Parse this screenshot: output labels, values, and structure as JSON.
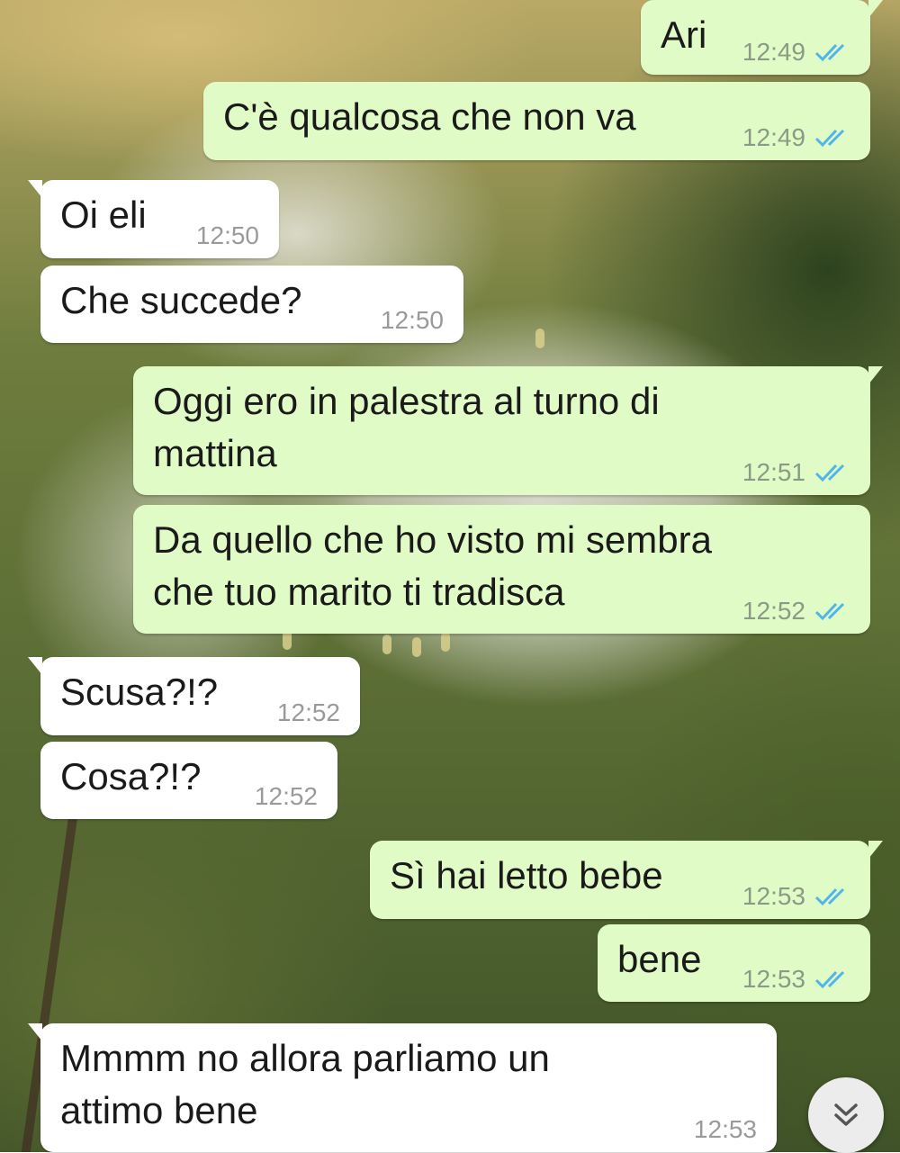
{
  "chat": {
    "messages": [
      {
        "direction": "outgoing",
        "text": "Ari",
        "time": "12:49",
        "status": "read"
      },
      {
        "direction": "outgoing",
        "text": "C'è qualcosa che non va",
        "time": "12:49",
        "status": "read"
      },
      {
        "direction": "incoming",
        "text": "Oi eli",
        "time": "12:50"
      },
      {
        "direction": "incoming",
        "text": "Che succede?",
        "time": "12:50"
      },
      {
        "direction": "outgoing",
        "text": "Oggi ero in palestra al turno di\nmattina",
        "time": "12:51",
        "status": "read"
      },
      {
        "direction": "outgoing",
        "text": "Da quello che ho visto mi sembra\nche tuo marito ti tradisca",
        "time": "12:52",
        "status": "read"
      },
      {
        "direction": "incoming",
        "text": "Scusa?!?",
        "time": "12:52"
      },
      {
        "direction": "incoming",
        "text": "Cosa?!?",
        "time": "12:52"
      },
      {
        "direction": "outgoing",
        "text": "Sì hai letto bebe",
        "time": "12:53",
        "status": "read"
      },
      {
        "direction": "outgoing",
        "text": "bene",
        "time": "12:53",
        "status": "read"
      },
      {
        "direction": "incoming",
        "text": "Mmmm no allora parliamo un\nattimo bene",
        "time": "12:53"
      }
    ],
    "scroll_button_icon": "double-chevron-down-icon"
  },
  "colors": {
    "outgoing_bubble": "#e1fbc6",
    "incoming_bubble": "#ffffff",
    "read_ticks": "#4fb6ec"
  }
}
